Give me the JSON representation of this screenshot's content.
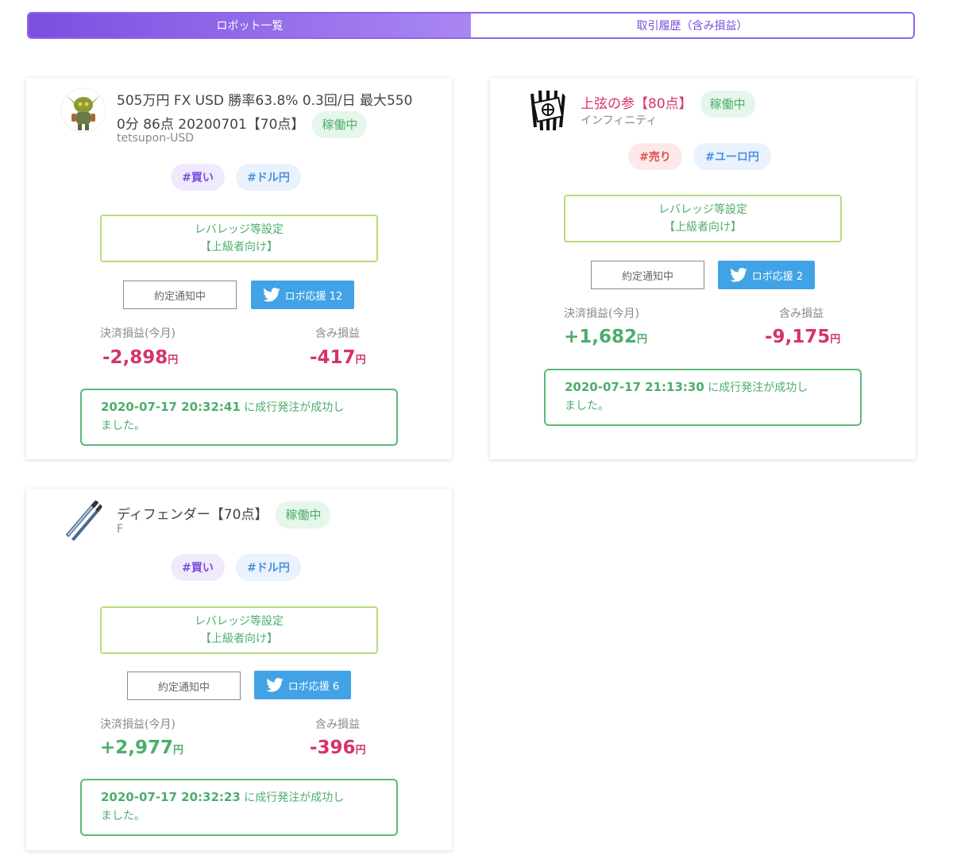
{
  "tabs": [
    {
      "label": "ロボット一覧",
      "active": true
    },
    {
      "label": "取引履歴（含み損益）",
      "active": false
    }
  ],
  "robots": [
    {
      "title": "505万円 FX USD 勝率63.8% 0.3回/日 最大5500分 86点 20200701【70点】",
      "title_line1": "505万円 FX USD 勝率63.8% 0.3回/日 最大550",
      "title_line2": "0分 86点 20200701【70点】",
      "status": "稼働中",
      "subtitle": "tetsupon-USD",
      "tags": [
        "#買い",
        "#ドル円"
      ],
      "leverage_line1": "レバレッジ等設定",
      "leverage_line2": "【上級者向け】",
      "notify_label": "約定通知中",
      "twitter_label": "ロボ応援 12",
      "realized_label": "決済損益(今月)",
      "realized_value": "-2,898",
      "unrealized_label": "含み損益",
      "unrealized_value": "-417",
      "yen": "円",
      "msg_timestamp": "2020-07-17 20:32:41",
      "msg_line1_rest": " に成行発注が成功し",
      "msg_line2": "ました。",
      "avatar_icon": "goblin-robot-icon"
    },
    {
      "title": "上弦の参【80点】",
      "status": "稼働中",
      "subtitle": "インフィニティ",
      "tags": [
        "#売り",
        "#ユーロ円"
      ],
      "leverage_line1": "レバレッジ等設定",
      "leverage_line2": "【上級者向け】",
      "notify_label": "約定通知中",
      "twitter_label": "ロボ応援 2",
      "realized_label": "決済損益(今月)",
      "realized_value": "+1,682",
      "unrealized_label": "含み損益",
      "unrealized_value": "-9,175",
      "yen": "円",
      "msg_timestamp": "2020-07-17 21:13:30",
      "msg_line1_rest": " に成行発注が成功し",
      "msg_line2": "ました。",
      "avatar_icon": "striped-emblem-icon"
    },
    {
      "title": "ディフェンダー【70点】",
      "status": "稼働中",
      "subtitle": "F",
      "tags": [
        "#買い",
        "#ドル円"
      ],
      "leverage_line1": "レバレッジ等設定",
      "leverage_line2": "【上級者向け】",
      "notify_label": "約定通知中",
      "twitter_label": "ロボ応援 6",
      "realized_label": "決済損益(今月)",
      "realized_value": "+2,977",
      "unrealized_label": "含み損益",
      "unrealized_value": "-396",
      "yen": "円",
      "msg_timestamp": "2020-07-17 20:32:23",
      "msg_line1_rest": " に成行発注が成功し",
      "msg_line2": "ました。",
      "avatar_icon": "swords-icon"
    }
  ],
  "colors": {
    "accent": "#7a4fe0",
    "status_bg": "#e6f6ea",
    "positive": "#4cae6c",
    "negative": "#d6336c",
    "twitter": "#41a3e6"
  }
}
